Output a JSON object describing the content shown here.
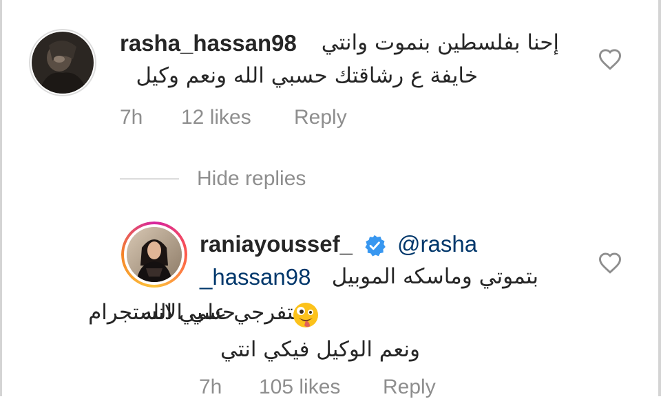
{
  "comment1": {
    "username": "rasha_hassan98",
    "text_line1": "إحنا بفلسطين بنموت وانتي",
    "text_line2": "خايفة ع رشاقتك حسبي الله ونعم وكيل",
    "time": "7h",
    "likes": "12 likes",
    "reply_label": "Reply"
  },
  "replies_toggle": {
    "label": "Hide replies"
  },
  "reply1": {
    "username": "raniayoussef_",
    "mention": "@rasha",
    "mention_cont": "_hassan98",
    "text_line1": "بتموتي وماسكه الموبيل",
    "text_line2_a": "وبتفرجي علي الانستجرام",
    "text_line2_b": "حسبي الله",
    "text_line3": "ونعم الوكيل فيكي انتي",
    "time": "7h",
    "likes": "105 likes",
    "reply_label": "Reply"
  },
  "icons": {
    "like": "heart-outline-icon",
    "verified": "verified-badge-icon",
    "emoji": "zany-face-emoji"
  },
  "colors": {
    "verified": "#3897f0",
    "mention": "#00376b",
    "meta": "#8e8e8e"
  }
}
